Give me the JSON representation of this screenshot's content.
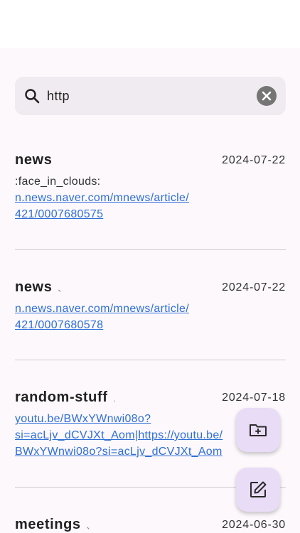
{
  "search": {
    "query": "http"
  },
  "notes": [
    {
      "title": "news",
      "date": "2024-07-22",
      "text": ":face_in_clouds:",
      "link_lines": [
        "n.news.naver.com/mnews/article/",
        "421/0007680575"
      ]
    },
    {
      "title": "news",
      "title_mark": "、",
      "date": "2024-07-22",
      "link_lines": [
        "n.news.naver.com/mnews/article/",
        "421/0007680578"
      ]
    },
    {
      "title": "random-stuff",
      "title_mark": ".",
      "date": "2024-07-18",
      "link_lines": [
        "youtu.be/BWxYWnwi08o?",
        "si=acLjv_dCVJXt_Aom|https://youtu.be/",
        "BWxYWnwi08o?si=acLjv_dCVJXt_Aom"
      ]
    },
    {
      "title": "meetings",
      "title_mark": "、",
      "date": "2024-06-30"
    }
  ],
  "icons": {
    "search": "search-icon",
    "clear": "close-circle-icon",
    "new_folder": "folder-plus-icon",
    "compose": "edit-icon"
  },
  "colors": {
    "link": "#2f6fd6",
    "fab_background": "#e9dcf6",
    "search_background": "#f0ebf0",
    "page_background": "#fcf8fc"
  }
}
